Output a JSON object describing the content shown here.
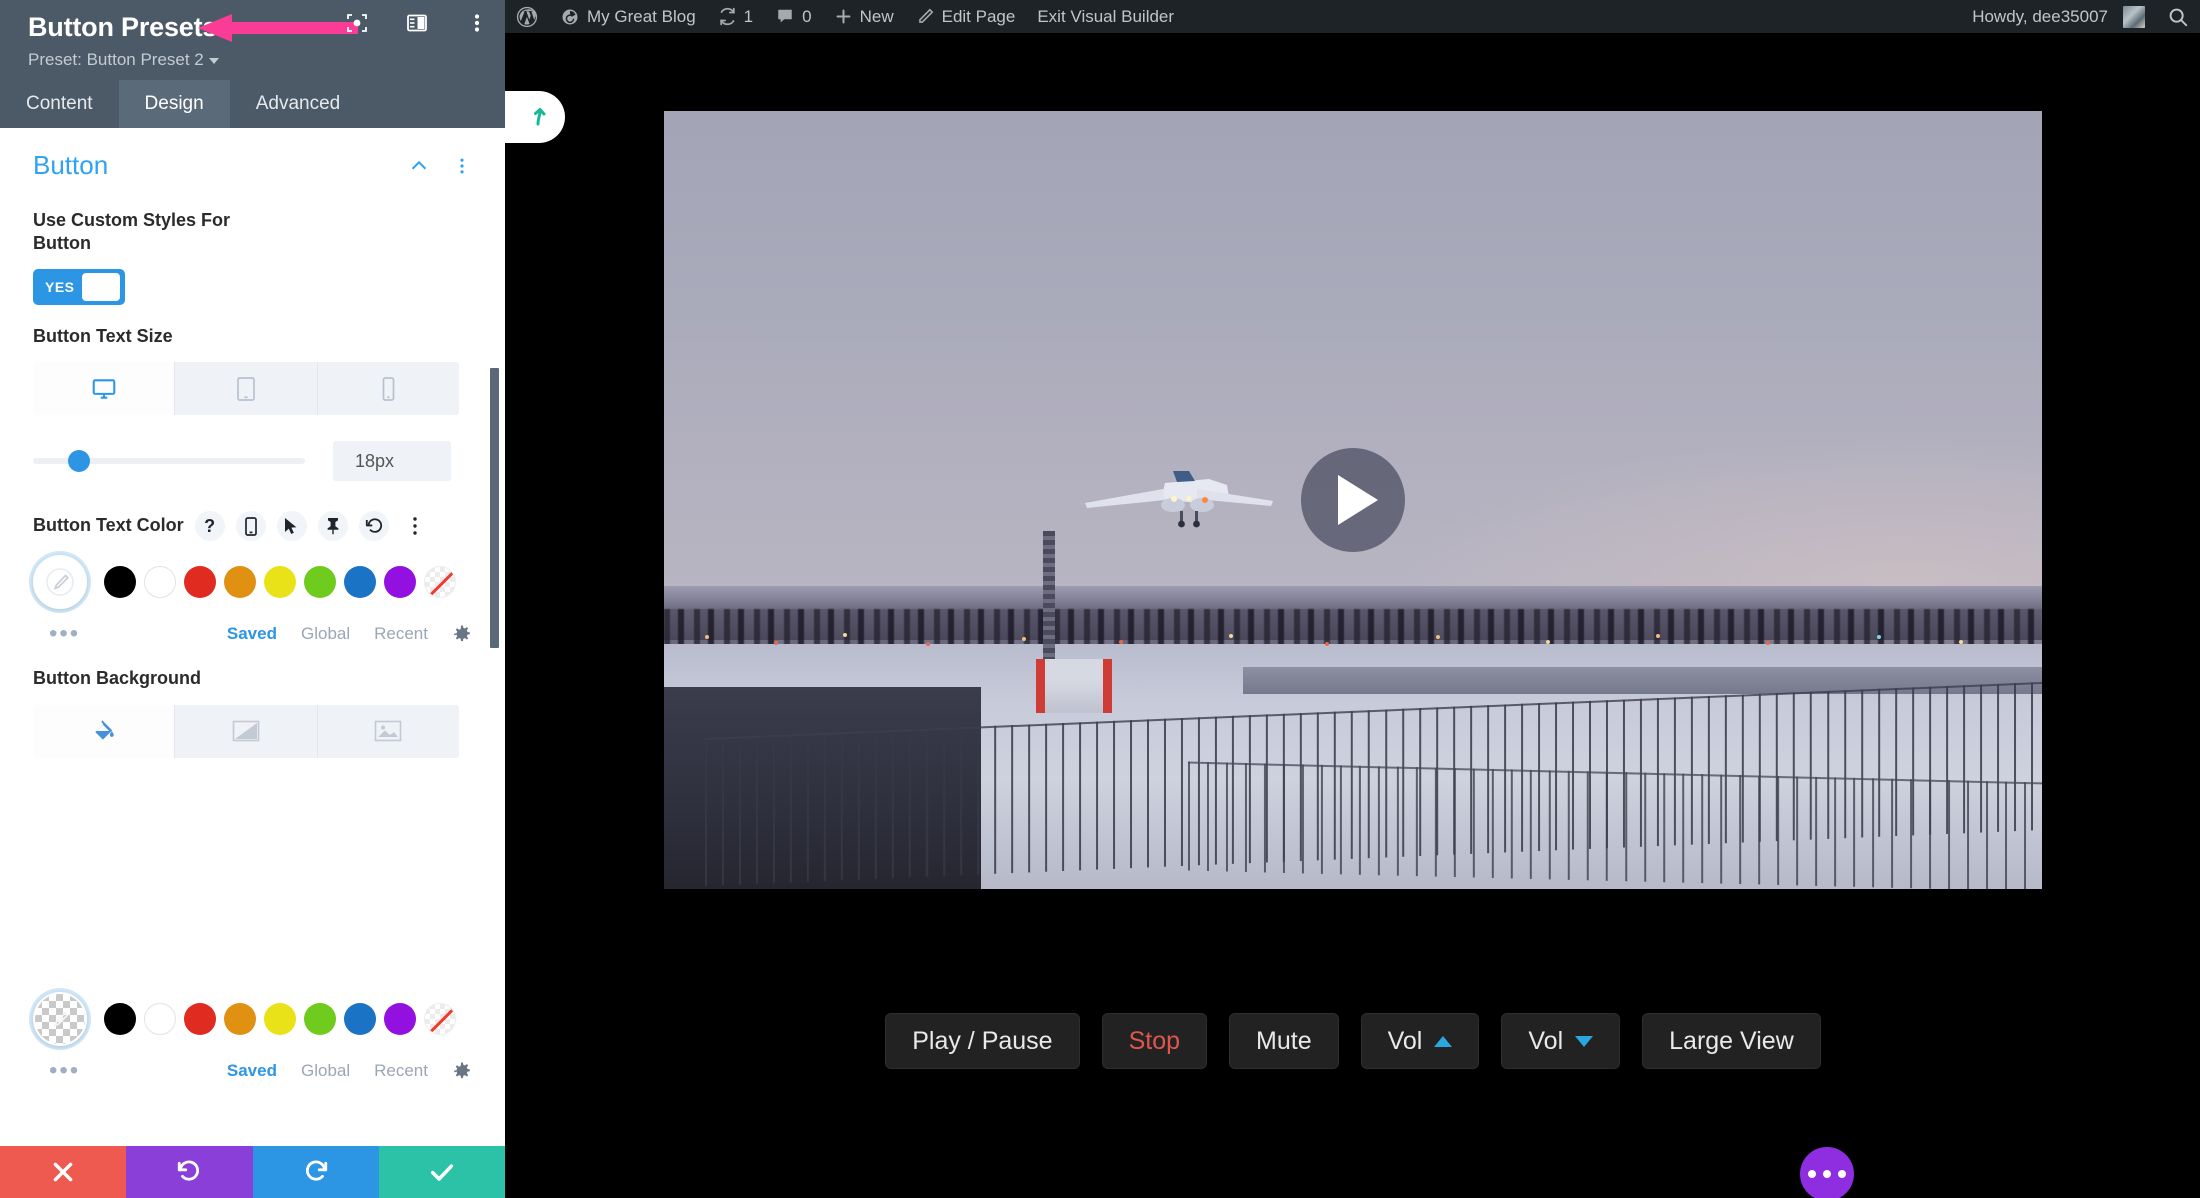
{
  "panel": {
    "title": "Button Presets",
    "preset_label": "Preset: Button Preset 2",
    "header_icons": [
      {
        "name": "focus-icon"
      },
      {
        "name": "panel-layout-icon"
      },
      {
        "name": "more-vertical-icon"
      }
    ],
    "tabs": [
      {
        "label": "Content",
        "active": false
      },
      {
        "label": "Design",
        "active": true
      },
      {
        "label": "Advanced",
        "active": false
      }
    ],
    "section": {
      "title": "Button",
      "collapse_icon": "chevron-up-icon",
      "menu_icon": "more-vertical-icon"
    },
    "custom_styles": {
      "label": "Use Custom Styles For Button",
      "toggle_value": "YES"
    },
    "text_size": {
      "label": "Button Text Size",
      "devices": [
        {
          "name": "desktop-icon",
          "active": true
        },
        {
          "name": "tablet-icon",
          "active": false
        },
        {
          "name": "phone-icon",
          "active": false
        }
      ],
      "value": "18px",
      "slider_percent": 13
    },
    "text_color": {
      "label": "Button Text Color",
      "icons": [
        {
          "name": "help-icon",
          "glyph": "?"
        },
        {
          "name": "responsive-phone-icon"
        },
        {
          "name": "hover-cursor-icon"
        },
        {
          "name": "sticky-pin-icon"
        },
        {
          "name": "reset-undo-icon"
        },
        {
          "name": "more-vertical-icon"
        }
      ],
      "lead_swatch": "eyedropper-swatch",
      "swatches": [
        "#000000",
        "#ffffff",
        "#e02b20",
        "#e09112",
        "#eae218",
        "#6fcc1e",
        "#1a73c4",
        "#9211e0",
        "transparent"
      ],
      "links": [
        {
          "label": "Saved",
          "active": true
        },
        {
          "label": "Global",
          "active": false
        },
        {
          "label": "Recent",
          "active": false
        }
      ],
      "gear_icon": "gear-icon",
      "more_icon": "ellipsis-icon"
    },
    "background": {
      "label": "Button Background",
      "types": [
        {
          "name": "solid-fill-icon",
          "active": true
        },
        {
          "name": "gradient-icon",
          "active": false
        },
        {
          "name": "image-icon",
          "active": false
        }
      ],
      "lead_swatch": "transparent-checker-swatch",
      "swatches": [
        "#000000",
        "#ffffff",
        "#e02b20",
        "#e09112",
        "#eae218",
        "#6fcc1e",
        "#1a73c4",
        "#9211e0",
        "transparent"
      ],
      "links": [
        {
          "label": "Saved",
          "active": true
        },
        {
          "label": "Global",
          "active": false
        },
        {
          "label": "Recent",
          "active": false
        }
      ],
      "gear_icon": "gear-icon",
      "more_icon": "ellipsis-icon"
    },
    "actions": [
      {
        "name": "cancel-button",
        "icon": "close-icon",
        "color": "#ee5a50"
      },
      {
        "name": "undo-button",
        "icon": "undo-icon",
        "color": "#8a3fd8"
      },
      {
        "name": "redo-button",
        "icon": "redo-icon",
        "color": "#2d96e4"
      },
      {
        "name": "save-button",
        "icon": "check-icon",
        "color": "#2bc2a8"
      }
    ],
    "annotation": {
      "name": "pink-arrow-annotation",
      "color": "#fb3c96"
    }
  },
  "adminbar": {
    "wp_logo": "wordpress-logo-icon",
    "site_name": "My Great Blog",
    "updates_count": "1",
    "comments_count": "0",
    "new_label": "New",
    "edit_page_label": "Edit Page",
    "exit_builder_label": "Exit Visual Builder",
    "howdy": "Howdy, dee35007",
    "search_icon": "search-icon"
  },
  "content": {
    "reopen_tab_icon": "curved-arrow-icon",
    "video": {
      "name": "video-player",
      "play_icon": "play-icon",
      "description": "Airplane landing over snowy airfield at dusk"
    },
    "controls": [
      {
        "label": "Play / Pause",
        "name": "play-pause-button",
        "style": "default"
      },
      {
        "label": "Stop",
        "name": "stop-button",
        "style": "danger"
      },
      {
        "label": "Mute",
        "name": "mute-button",
        "style": "default"
      },
      {
        "label": "Vol",
        "name": "volume-up-button",
        "style": "default",
        "arrow": "up"
      },
      {
        "label": "Vol",
        "name": "volume-down-button",
        "style": "default",
        "arrow": "down"
      },
      {
        "label": "Large View",
        "name": "large-view-button",
        "style": "default"
      }
    ],
    "fab": {
      "name": "page-settings-fab",
      "icon": "ellipsis-icon",
      "color": "#8f2de0"
    }
  }
}
